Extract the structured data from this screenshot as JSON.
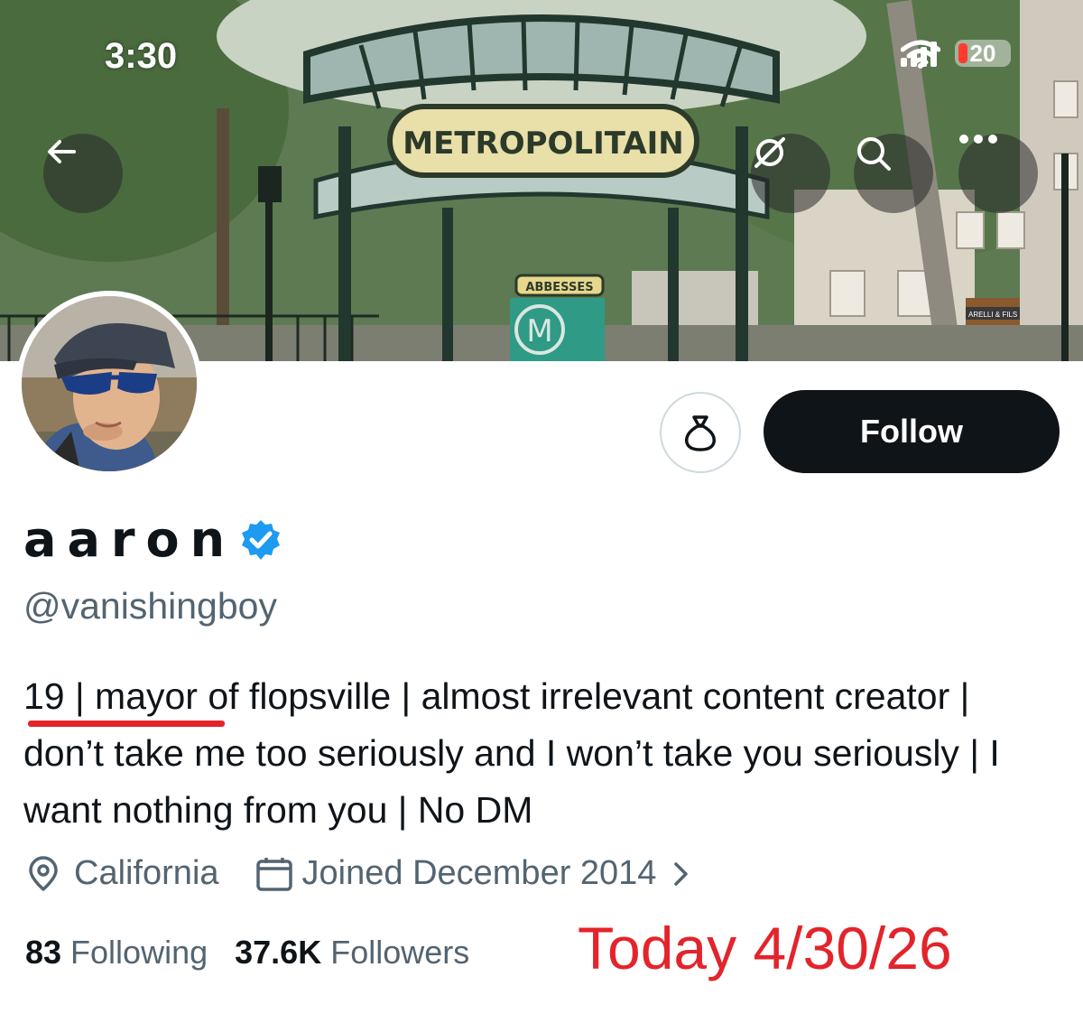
{
  "status_bar": {
    "time": "3:30",
    "battery_level": "20",
    "icons": [
      "cellular-signal-icon",
      "wifi-icon",
      "battery-icon"
    ]
  },
  "banner": {
    "sign_text": "METROPOLITAIN",
    "small_sign_text": "ABBESSES",
    "metro_letter": "M",
    "shop_sign_text": "ARELLI & FILS",
    "buttons": [
      "back-arrow-icon",
      "hide-reposts-icon",
      "search-icon",
      "more-icon"
    ]
  },
  "actions": {
    "gift_icon": "money-bag-icon",
    "follow_label": "Follow"
  },
  "profile": {
    "name": "aaron",
    "verified": true,
    "handle": "@vanishingboy",
    "bio": "19 | mayor of flopsville | almost irrelevant content creator | don’t take me too seriously and I won’t take you seriously | I want nothing from you | No DM",
    "location": "California",
    "joined": "Joined December 2014",
    "following_count": "83",
    "following_label": "Following",
    "followers_count": "37.6K",
    "followers_label": "Followers"
  },
  "annotation": {
    "text": "Today 4/30/26",
    "underline_target": "19 | mayor"
  },
  "colors": {
    "primary_text": "#0f1419",
    "secondary_text": "#536471",
    "verified_blue": "#1d9bf0",
    "annotation_red": "#e3242b",
    "follow_button": "#0f1419"
  }
}
